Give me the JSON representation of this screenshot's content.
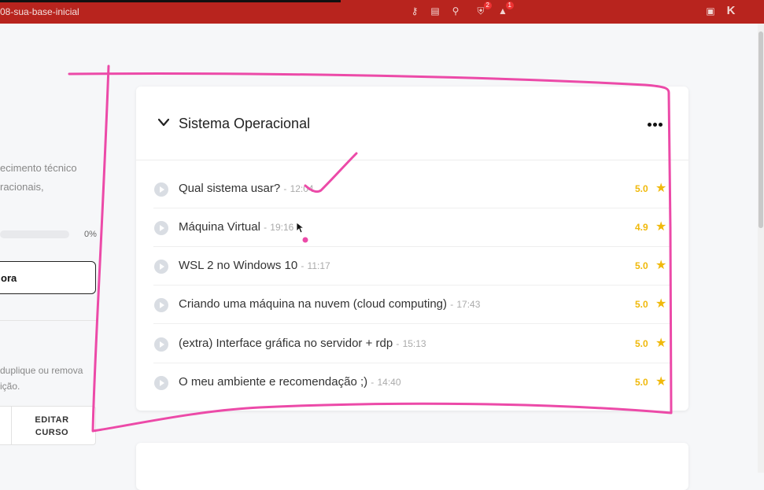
{
  "browser": {
    "tab_title": "08-sua-base-inicial",
    "icons": [
      "key-icon",
      "translate-icon",
      "zoom-icon",
      "brave-shield-icon",
      "rewards-icon",
      "wallet-icon",
      "extension-icon"
    ],
    "shield_badge": "2",
    "rewards_badge": "1"
  },
  "left_panel": {
    "desc_line1": "ecimento técnico",
    "desc_line2": "racionais,",
    "progress_percent": "0%",
    "progress_value": 0,
    "action_button": "ora",
    "hint_line1": "duplique ou remova",
    "hint_line2": "ição.",
    "edit_line1": "EDITAR",
    "edit_line2": "CURSO"
  },
  "module": {
    "title": "Sistema Operacional",
    "lessons": [
      {
        "title": "Qual sistema usar?",
        "duration": "12:04",
        "rating": "5.0"
      },
      {
        "title": "Máquina Virtual",
        "duration": "19:16",
        "rating": "4.9"
      },
      {
        "title": "WSL 2 no Windows 10",
        "duration": "11:17",
        "rating": "5.0"
      },
      {
        "title": "Criando uma máquina na nuvem (cloud computing)",
        "duration": "17:43",
        "rating": "5.0"
      },
      {
        "title": "(extra) Interface gráfica no servidor + rdp",
        "duration": "15:13",
        "rating": "5.0"
      },
      {
        "title": "O meu ambiente e recomendação ;)",
        "duration": "14:40",
        "rating": "5.0"
      }
    ],
    "separator": "-"
  },
  "colors": {
    "browser_bar": "#b8241e",
    "rating": "#f0b90b",
    "annotation": "#ec4aa8"
  }
}
